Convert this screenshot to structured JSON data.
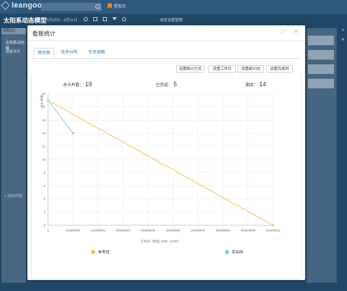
{
  "app": {
    "name": "leangoo"
  },
  "topbar": {
    "search_placeholder": "",
    "favorites_label": "看板库"
  },
  "project": {
    "title": "太阳系动态模型",
    "date_range": "5月29日 - 6月11日",
    "member_manage": "成员设置管理"
  },
  "board": {
    "column_header": "目标(1)",
    "items": [
      "太阳系动态模",
      "添加卡片"
    ],
    "add_list": "+ 添加列表"
  },
  "modal": {
    "title": "看板统计",
    "tabs": [
      {
        "label": "燃尽图",
        "active": true
      },
      {
        "label": "任务分布",
        "active": false
      },
      {
        "label": "任务周期",
        "active": false
      }
    ],
    "buttons": [
      "设置统计方式",
      "设置工作日",
      "设置统计向",
      "设置完成列"
    ],
    "stats": {
      "total_label": "总卡片数：",
      "total": "19",
      "done_label": "已完成：",
      "done": "5",
      "remaining_label": "剩余：",
      "remaining": "14"
    }
  },
  "chart_data": {
    "type": "line",
    "ylabel": "剩余卡片",
    "xlabel": "工作日（时区 GMT +8:00）",
    "categories": [
      "0",
      "2016/06/20",
      "2016/06/21",
      "2016/06/22",
      "2016/06/05",
      "2016/06/06",
      "2016/06/07",
      "2016/06/08",
      "2016/06/09",
      "2016/06/11"
    ],
    "ylim": [
      0,
      20
    ],
    "yticks": [
      0,
      2,
      4,
      6,
      8,
      10,
      12,
      14,
      16,
      18,
      20
    ],
    "series": [
      {
        "name": "参考线",
        "color": "#f0c23b",
        "points": [
          [
            0,
            19
          ],
          [
            9,
            0
          ]
        ]
      },
      {
        "name": "实际线",
        "color": "#8cc6e6",
        "points": [
          [
            0,
            19
          ],
          [
            1,
            14
          ]
        ]
      }
    ],
    "legend": "bottom",
    "grid": true
  }
}
